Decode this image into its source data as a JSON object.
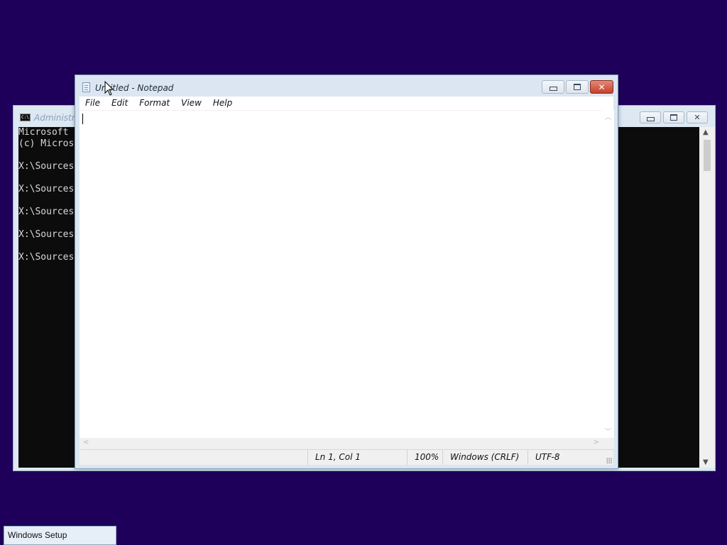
{
  "cmd": {
    "title": "Administra",
    "lines": [
      "Microsoft",
      "(c) Micros",
      "",
      "X:\\Sources",
      "",
      "X:\\Sources",
      "",
      "X:\\Sources",
      "",
      "X:\\Sources",
      "",
      "X:\\Sources"
    ],
    "buttons": {
      "minimize": "▭",
      "maximize": "▢",
      "close": "✕"
    }
  },
  "notepad": {
    "title": "Untitled - Notepad",
    "menu": [
      "File",
      "Edit",
      "Format",
      "View",
      "Help"
    ],
    "content": "",
    "status": {
      "position": "Ln 1, Col 1",
      "zoom": "100%",
      "line_ending": "Windows (CRLF)",
      "encoding": "UTF-8"
    },
    "buttons": {
      "minimize": "▭",
      "maximize": "▢",
      "close": "✕"
    }
  },
  "taskbar": {
    "button_label": "Windows Setup"
  },
  "colors": {
    "desktop": "#1e005a",
    "close_button": "#c5402a"
  }
}
